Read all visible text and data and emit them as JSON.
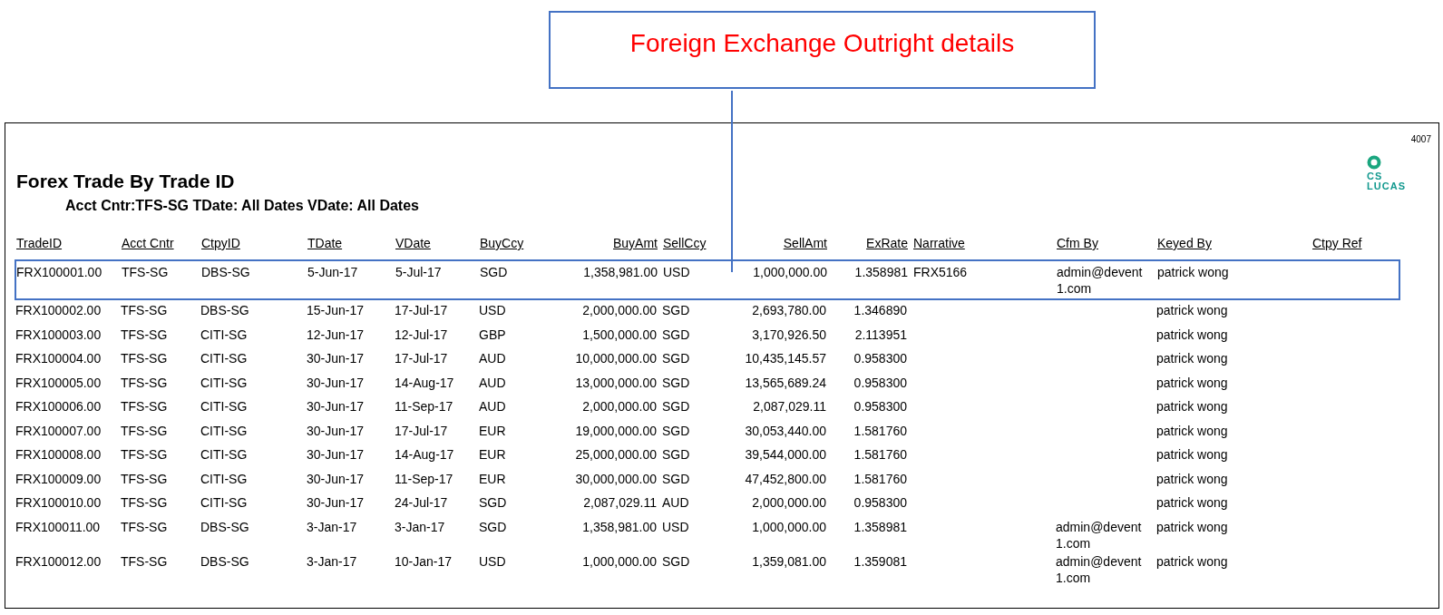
{
  "callout": {
    "text": "Foreign Exchange Outright details"
  },
  "report": {
    "page_number": "4007",
    "logo": {
      "line_1": "CS",
      "line_2": "LUCAS"
    },
    "title": "Forex Trade By Trade ID",
    "subtitle": "Acct Cntr:TFS-SG TDate: All Dates VDate: All Dates"
  },
  "table": {
    "columns": [
      "TradeID",
      "Acct Cntr",
      "CtpyID",
      "TDate",
      "VDate",
      "BuyCcy",
      "BuyAmt",
      "SellCcy",
      "SellAmt",
      "ExRate",
      "Narrative",
      "Cfm By",
      "Keyed By",
      "Ctpy Ref"
    ],
    "rows": [
      {
        "selected": true,
        "cells": [
          "FRX100001.00",
          "TFS-SG",
          "DBS-SG",
          "5-Jun-17",
          "5-Jul-17",
          "SGD",
          "1,358,981.00",
          "USD",
          "1,000,000.00",
          "1.358981",
          "FRX5166",
          "admin@devent1.com",
          "patrick wong",
          ""
        ]
      },
      {
        "selected": false,
        "cells": [
          "FRX100002.00",
          "TFS-SG",
          "DBS-SG",
          "15-Jun-17",
          "17-Jul-17",
          "USD",
          "2,000,000.00",
          "SGD",
          "2,693,780.00",
          "1.346890",
          "",
          "",
          "patrick wong",
          ""
        ]
      },
      {
        "selected": false,
        "cells": [
          "FRX100003.00",
          "TFS-SG",
          "CITI-SG",
          "12-Jun-17",
          "12-Jul-17",
          "GBP",
          "1,500,000.00",
          "SGD",
          "3,170,926.50",
          "2.113951",
          "",
          "",
          "patrick wong",
          ""
        ]
      },
      {
        "selected": false,
        "cells": [
          "FRX100004.00",
          "TFS-SG",
          "CITI-SG",
          "30-Jun-17",
          "17-Jul-17",
          "AUD",
          "10,000,000.00",
          "SGD",
          "10,435,145.57",
          "0.958300",
          "",
          "",
          "patrick wong",
          ""
        ]
      },
      {
        "selected": false,
        "cells": [
          "FRX100005.00",
          "TFS-SG",
          "CITI-SG",
          "30-Jun-17",
          "14-Aug-17",
          "AUD",
          "13,000,000.00",
          "SGD",
          "13,565,689.24",
          "0.958300",
          "",
          "",
          "patrick wong",
          ""
        ]
      },
      {
        "selected": false,
        "cells": [
          "FRX100006.00",
          "TFS-SG",
          "CITI-SG",
          "30-Jun-17",
          "11-Sep-17",
          "AUD",
          "2,000,000.00",
          "SGD",
          "2,087,029.11",
          "0.958300",
          "",
          "",
          "patrick wong",
          ""
        ]
      },
      {
        "selected": false,
        "cells": [
          "FRX100007.00",
          "TFS-SG",
          "CITI-SG",
          "30-Jun-17",
          "17-Jul-17",
          "EUR",
          "19,000,000.00",
          "SGD",
          "30,053,440.00",
          "1.581760",
          "",
          "",
          "patrick wong",
          ""
        ]
      },
      {
        "selected": false,
        "cells": [
          "FRX100008.00",
          "TFS-SG",
          "CITI-SG",
          "30-Jun-17",
          "14-Aug-17",
          "EUR",
          "25,000,000.00",
          "SGD",
          "39,544,000.00",
          "1.581760",
          "",
          "",
          "patrick wong",
          ""
        ]
      },
      {
        "selected": false,
        "cells": [
          "FRX100009.00",
          "TFS-SG",
          "CITI-SG",
          "30-Jun-17",
          "11-Sep-17",
          "EUR",
          "30,000,000.00",
          "SGD",
          "47,452,800.00",
          "1.581760",
          "",
          "",
          "patrick wong",
          ""
        ]
      },
      {
        "selected": false,
        "cells": [
          "FRX100010.00",
          "TFS-SG",
          "CITI-SG",
          "30-Jun-17",
          "24-Jul-17",
          "SGD",
          "2,087,029.11",
          "AUD",
          "2,000,000.00",
          "0.958300",
          "",
          "",
          "patrick wong",
          ""
        ]
      },
      {
        "selected": false,
        "cells": [
          "FRX100011.00",
          "TFS-SG",
          "DBS-SG",
          "3-Jan-17",
          "3-Jan-17",
          "SGD",
          "1,358,981.00",
          "USD",
          "1,000,000.00",
          "1.358981",
          "",
          "admin@devent1.com",
          "patrick wong",
          ""
        ]
      },
      {
        "selected": false,
        "cells": [
          "FRX100012.00",
          "TFS-SG",
          "DBS-SG",
          "3-Jan-17",
          "10-Jan-17",
          "USD",
          "1,000,000.00",
          "SGD",
          "1,359,081.00",
          "1.359081",
          "",
          "admin@devent1.com",
          "patrick wong",
          ""
        ]
      }
    ]
  }
}
